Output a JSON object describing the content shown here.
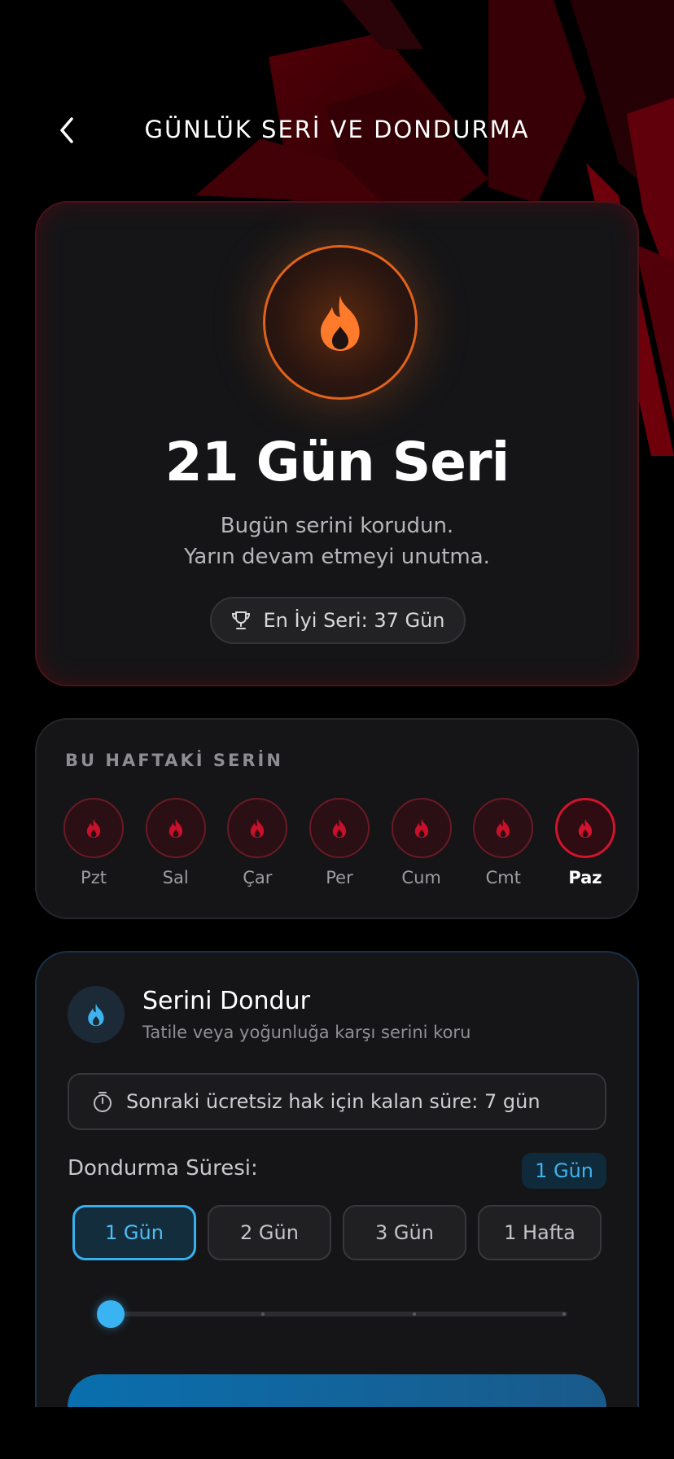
{
  "header": {
    "title": "GÜNLÜK SERİ VE DONDURMA",
    "back_icon": "chevron-left-icon"
  },
  "streak": {
    "icon": "flame-icon",
    "title": "21 Gün Seri",
    "subtitle_line1": "Bugün serini korudun.",
    "subtitle_line2": "Yarın devam etmeyi unutma.",
    "best_icon": "trophy-icon",
    "best_label": "En İyi Seri: 37 Gün"
  },
  "week": {
    "title": "BU HAFTAKİ SERİN",
    "days": [
      {
        "label": "Pzt",
        "completed": true,
        "today": false
      },
      {
        "label": "Sal",
        "completed": true,
        "today": false
      },
      {
        "label": "Çar",
        "completed": true,
        "today": false
      },
      {
        "label": "Per",
        "completed": true,
        "today": false
      },
      {
        "label": "Cum",
        "completed": true,
        "today": false
      },
      {
        "label": "Cmt",
        "completed": true,
        "today": false
      },
      {
        "label": "Paz",
        "completed": true,
        "today": true
      }
    ]
  },
  "freeze": {
    "icon": "flame-blue-icon",
    "title": "Serini Dondur",
    "subtitle": "Tatile veya yoğunluğa karşı serini koru",
    "timer_icon": "stopwatch-icon",
    "timer_text": "Sonraki ücretsiz hak için kalan süre: 7 gün",
    "duration_label": "Dondurma Süresi:",
    "selected_badge": "1 Gün",
    "options": [
      "1 Gün",
      "2 Gün",
      "3 Gün",
      "1 Hafta"
    ],
    "selected_index": 0
  },
  "colors": {
    "accent_orange": "#e2621a",
    "accent_red": "#d0142c",
    "accent_blue": "#38b0f0",
    "card_bg": "#151517"
  }
}
